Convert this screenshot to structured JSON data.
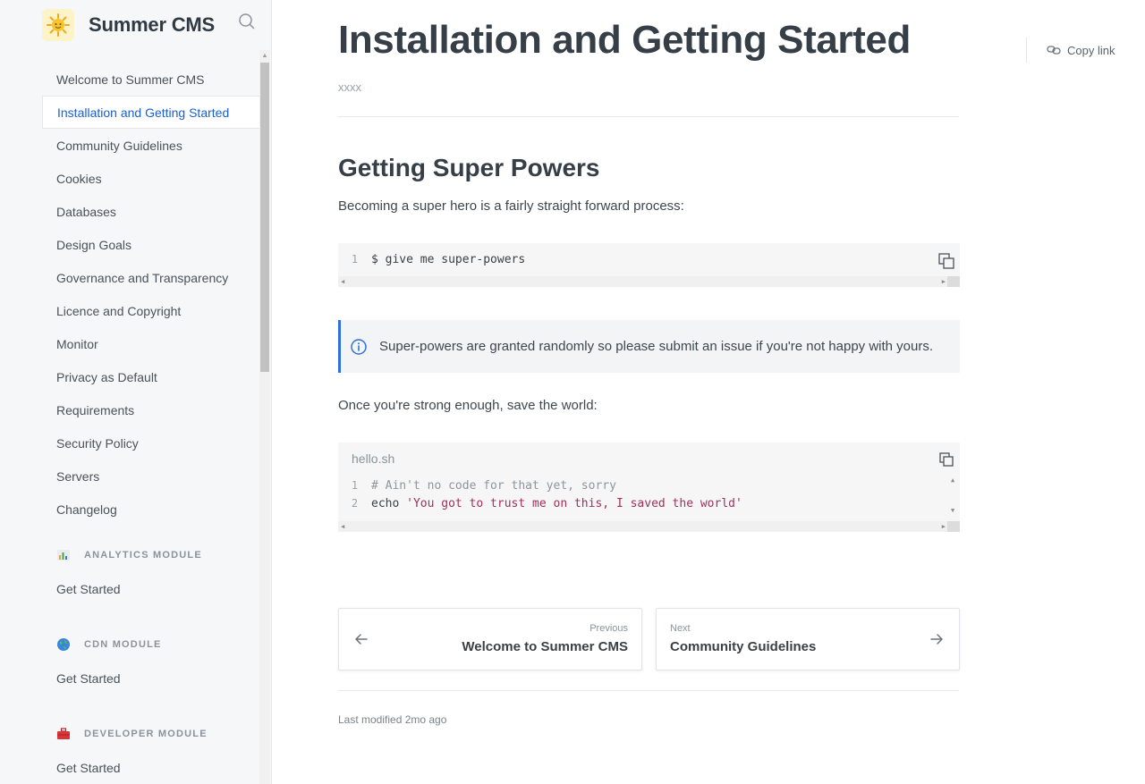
{
  "brand": {
    "name": "Summer CMS",
    "logo_icon": "sun-icon"
  },
  "sidebar": {
    "items": [
      {
        "label": "Welcome to Summer CMS",
        "active": false
      },
      {
        "label": "Installation and Getting Started",
        "active": true
      },
      {
        "label": "Community Guidelines",
        "active": false
      },
      {
        "label": "Cookies",
        "active": false
      },
      {
        "label": "Databases",
        "active": false
      },
      {
        "label": "Design Goals",
        "active": false
      },
      {
        "label": "Governance and Transparency",
        "active": false
      },
      {
        "label": "Licence and Copyright",
        "active": false
      },
      {
        "label": "Monitor",
        "active": false
      },
      {
        "label": "Privacy as Default",
        "active": false
      },
      {
        "label": "Requirements",
        "active": false
      },
      {
        "label": "Security Policy",
        "active": false
      },
      {
        "label": "Servers",
        "active": false
      },
      {
        "label": "Changelog",
        "active": false
      }
    ],
    "sections": [
      {
        "title": "ANALYTICS MODULE",
        "icon": "bar-chart-icon",
        "items": [
          "Get Started"
        ]
      },
      {
        "title": "CDN MODULE",
        "icon": "globe-icon",
        "items": [
          "Get Started"
        ]
      },
      {
        "title": "DEVELOPER MODULE",
        "icon": "toolbox-icon",
        "items": [
          "Get Started"
        ]
      }
    ]
  },
  "page": {
    "title": "Installation and Getting Started",
    "subtitle": "xxxx",
    "copy_link_label": "Copy link",
    "h2": "Getting Super Powers",
    "intro": "Becoming a super hero is a fairly straight forward process:",
    "code1": {
      "lines": [
        {
          "n": "1",
          "text": "$ give me super-powers"
        }
      ]
    },
    "callout": "Super-powers are granted randomly so please submit an issue if you're not happy with yours.",
    "para2": "Once you're strong enough, save the world:",
    "code2": {
      "filename": "hello.sh",
      "lines": [
        {
          "n": "1",
          "comment": "# Ain't no code for that yet, sorry"
        },
        {
          "n": "2",
          "kw": "echo ",
          "str": "'You got to trust me on this, I saved the world'"
        }
      ]
    },
    "prev": {
      "label": "Previous",
      "title": "Welcome to Summer CMS"
    },
    "next": {
      "label": "Next",
      "title": "Community Guidelines"
    },
    "last_modified": "Last modified 2mo ago"
  },
  "colors": {
    "accent": "#1a5fd4",
    "callout_border": "#2f6fde",
    "string": "#a0305a"
  }
}
